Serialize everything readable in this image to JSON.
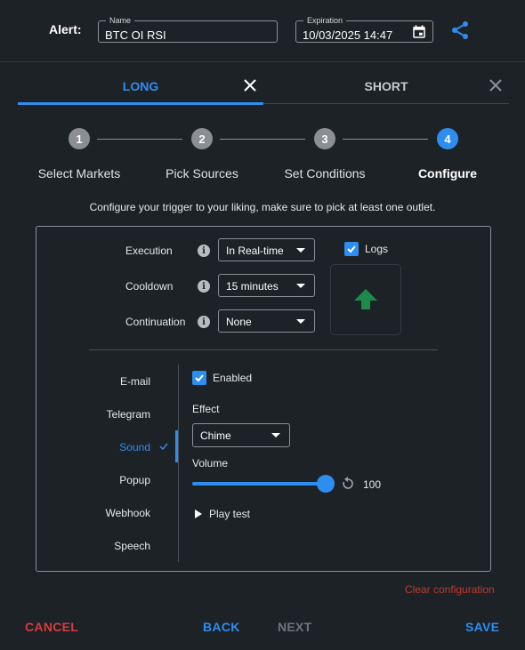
{
  "header": {
    "alert_label": "Alert:",
    "name_legend": "Name",
    "name_value": "BTC OI RSI",
    "expiration_legend": "Expiration",
    "expiration_value": "10/03/2025 14:47"
  },
  "tabs": [
    {
      "label": "LONG",
      "active": true
    },
    {
      "label": "SHORT",
      "active": false
    }
  ],
  "steps": [
    {
      "number": "1",
      "label": "Select Markets"
    },
    {
      "number": "2",
      "label": "Pick Sources"
    },
    {
      "number": "3",
      "label": "Set Conditions"
    },
    {
      "number": "4",
      "label": "Configure"
    }
  ],
  "instructions": "Configure your trigger to your liking, make sure to pick at least one outlet.",
  "settings": {
    "execution": {
      "label": "Execution",
      "value": "In Real-time"
    },
    "cooldown": {
      "label": "Cooldown",
      "value": "15 minutes"
    },
    "continuation": {
      "label": "Continuation",
      "value": "None"
    },
    "info_glyph": "i"
  },
  "logs": {
    "label": "Logs",
    "checked": true
  },
  "outlets": [
    "E-mail",
    "Telegram",
    "Sound",
    "Popup",
    "Webhook",
    "Speech"
  ],
  "active_outlet": "Sound",
  "sound_panel": {
    "enabled_label": "Enabled",
    "effect_label": "Effect",
    "effect_value": "Chime",
    "volume_label": "Volume",
    "volume_value": "100",
    "play_test_label": "Play test"
  },
  "clear_label": "Clear configuration",
  "footer": {
    "cancel": "CANCEL",
    "back": "BACK",
    "next": "NEXT",
    "save": "SAVE"
  },
  "colors": {
    "accent": "#2d8ef0",
    "danger": "#d63c3c",
    "arrow": "#1e8a4a",
    "background": "#1d2227"
  }
}
